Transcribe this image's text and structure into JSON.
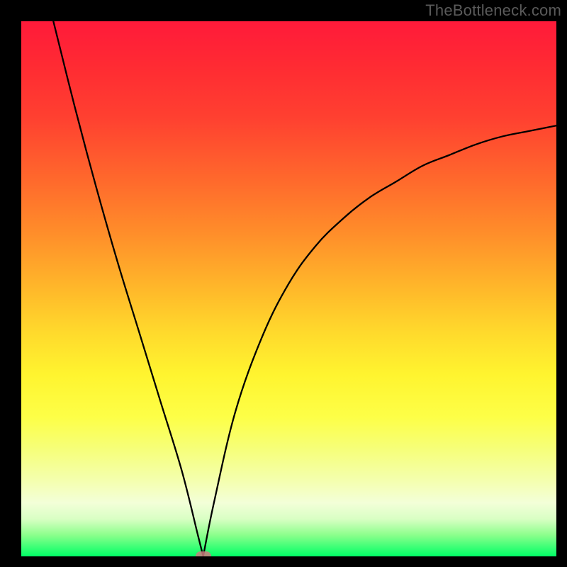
{
  "watermark": "TheBottleneck.com",
  "chart_data": {
    "type": "line",
    "title": "",
    "xlabel": "",
    "ylabel": "",
    "xlim": [
      0,
      100
    ],
    "ylim": [
      0,
      100
    ],
    "grid": false,
    "legend": false,
    "background": {
      "type": "vertical-gradient",
      "stops": [
        {
          "pos": 0,
          "color": "#ff1a3a"
        },
        {
          "pos": 50,
          "color": "#ffd02c"
        },
        {
          "pos": 80,
          "color": "#f6ff7a"
        },
        {
          "pos": 100,
          "color": "#00ff66"
        }
      ]
    },
    "vertex_x": 34,
    "marker": {
      "x": 34,
      "y": 0,
      "color": "#cc7a7f"
    },
    "series": [
      {
        "name": "left-branch",
        "x": [
          6,
          10,
          14,
          18,
          22,
          26,
          30,
          33,
          34
        ],
        "values": [
          100,
          84,
          69,
          55,
          42,
          29,
          16,
          4,
          0
        ]
      },
      {
        "name": "right-branch",
        "x": [
          34,
          36,
          40,
          45,
          50,
          55,
          60,
          65,
          70,
          75,
          80,
          85,
          90,
          95,
          100
        ],
        "values": [
          0,
          10,
          27,
          41,
          51,
          58,
          63,
          67,
          70,
          73,
          75,
          77,
          78.5,
          79.5,
          80.5
        ]
      }
    ],
    "line_style": {
      "color": "#000",
      "width": 2.3
    }
  }
}
